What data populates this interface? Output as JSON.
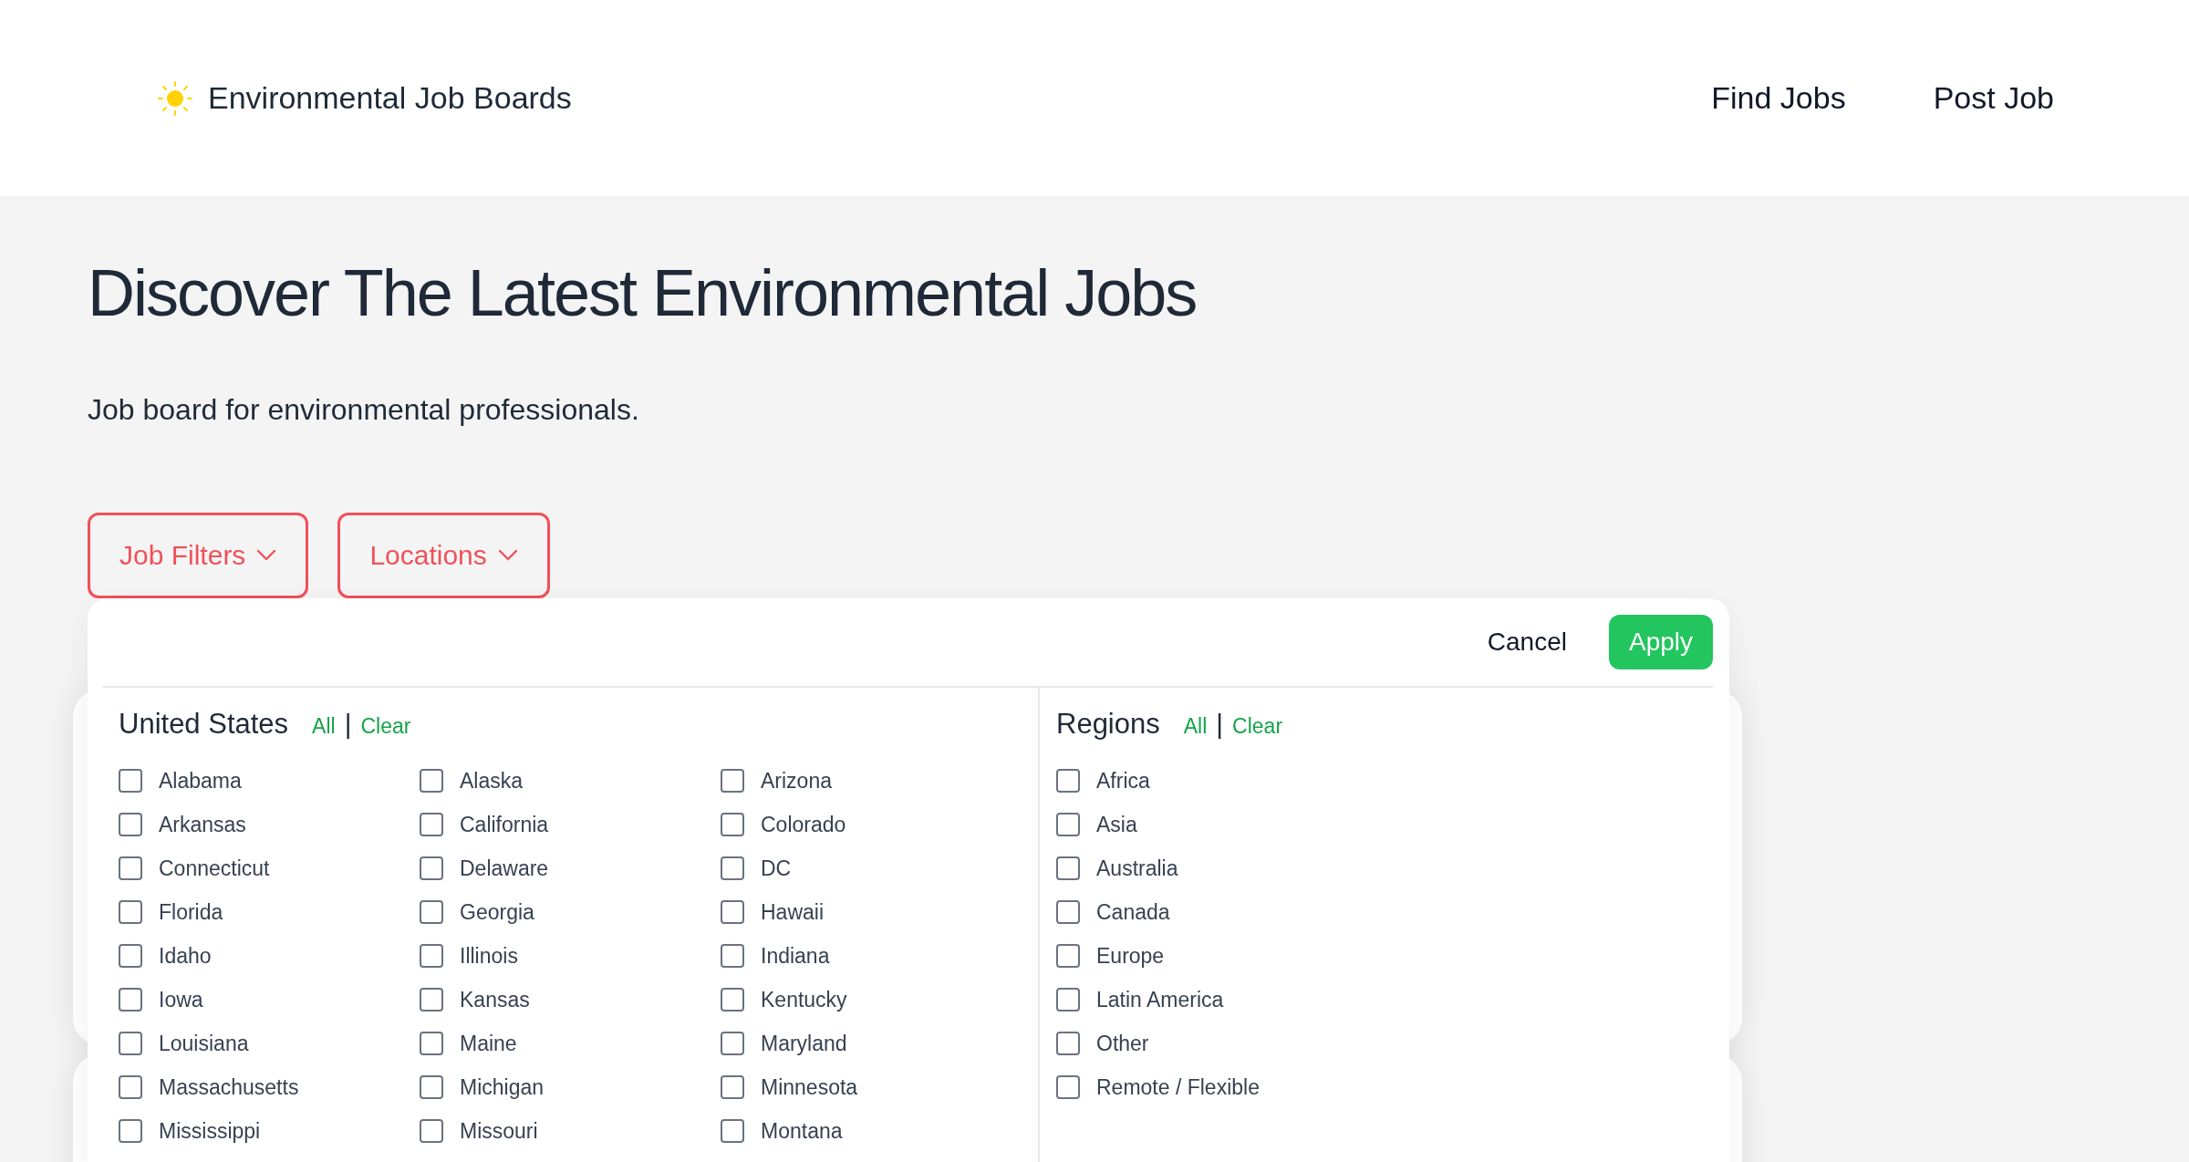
{
  "header": {
    "site_name": "Environmental Job Boards",
    "nav": [
      "Find Jobs",
      "Post Job"
    ]
  },
  "hero": {
    "title": "Discover The Latest Environmental Jobs",
    "subtitle": "Job board for environmental professionals."
  },
  "filter_buttons": [
    {
      "label": "Job Filters"
    },
    {
      "label": "Locations"
    }
  ],
  "locations_panel": {
    "cancel": "Cancel",
    "apply": "Apply",
    "sections": [
      {
        "title": "United States",
        "all": "All",
        "separator": "|",
        "clear": "Clear",
        "options": [
          {
            "label": "Alabama",
            "checked": false
          },
          {
            "label": "Alaska",
            "checked": false
          },
          {
            "label": "Arizona",
            "checked": false
          },
          {
            "label": "Arkansas",
            "checked": false
          },
          {
            "label": "California",
            "checked": false
          },
          {
            "label": "Colorado",
            "checked": false
          },
          {
            "label": "Connecticut",
            "checked": false
          },
          {
            "label": "Delaware",
            "checked": false
          },
          {
            "label": "DC",
            "checked": false
          },
          {
            "label": "Florida",
            "checked": false
          },
          {
            "label": "Georgia",
            "checked": false
          },
          {
            "label": "Hawaii",
            "checked": false
          },
          {
            "label": "Idaho",
            "checked": false
          },
          {
            "label": "Illinois",
            "checked": false
          },
          {
            "label": "Indiana",
            "checked": false
          },
          {
            "label": "Iowa",
            "checked": false
          },
          {
            "label": "Kansas",
            "checked": false
          },
          {
            "label": "Kentucky",
            "checked": false
          },
          {
            "label": "Louisiana",
            "checked": false
          },
          {
            "label": "Maine",
            "checked": false
          },
          {
            "label": "Maryland",
            "checked": false
          },
          {
            "label": "Massachusetts",
            "checked": false
          },
          {
            "label": "Michigan",
            "checked": false
          },
          {
            "label": "Minnesota",
            "checked": false
          },
          {
            "label": "Mississippi",
            "checked": false
          },
          {
            "label": "Missouri",
            "checked": false
          },
          {
            "label": "Montana",
            "checked": false
          }
        ]
      },
      {
        "title": "Regions",
        "all": "All",
        "separator": "|",
        "clear": "Clear",
        "options": [
          {
            "label": "Africa",
            "checked": false
          },
          {
            "label": "Asia",
            "checked": false
          },
          {
            "label": "Australia",
            "checked": false
          },
          {
            "label": "Canada",
            "checked": false
          },
          {
            "label": "Europe",
            "checked": false
          },
          {
            "label": "Latin America",
            "checked": false
          },
          {
            "label": "Other",
            "checked": false
          },
          {
            "label": "Remote / Flexible",
            "checked": false
          }
        ]
      }
    ]
  }
}
